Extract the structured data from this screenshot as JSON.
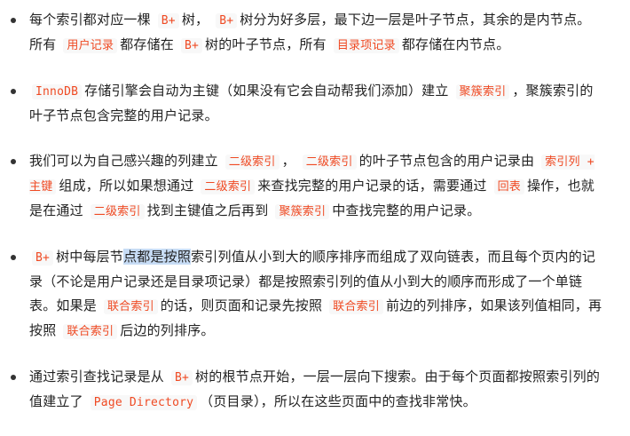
{
  "items": [
    [
      {
        "t": "每个索引都对应一棵 "
      },
      {
        "c": "B+"
      },
      {
        "t": "树， "
      },
      {
        "c": "B+"
      },
      {
        "t": "树分为好多层，最下边一层是叶子节点，其余的是内节点。所有 "
      },
      {
        "c": "用户记录"
      },
      {
        "t": "都存储在 "
      },
      {
        "c": "B+"
      },
      {
        "t": "树的叶子节点，所有 "
      },
      {
        "c": "目录项记录"
      },
      {
        "t": "都存储在内节点。"
      }
    ],
    [
      {
        "c": "InnoDB"
      },
      {
        "t": "存储引擎会自动为主键（如果没有它会自动帮我们添加）建立 "
      },
      {
        "c": "聚簇索引"
      },
      {
        "t": "，聚簇索引的叶子节点包含完整的用户记录。"
      }
    ],
    [
      {
        "t": "我们可以为自己感兴趣的列建立 "
      },
      {
        "c": "二级索引"
      },
      {
        "t": "， "
      },
      {
        "c": "二级索引"
      },
      {
        "t": "的叶子节点包含的用户记录由 "
      },
      {
        "c": "索引列 + 主键"
      },
      {
        "t": "组成，所以如果想通过 "
      },
      {
        "c": "二级索引"
      },
      {
        "t": "来查找完整的用户记录的话，需要通过 "
      },
      {
        "c": "回表"
      },
      {
        "t": "操作，也就是在通过 "
      },
      {
        "c": "二级索引"
      },
      {
        "t": "找到主键值之后再到 "
      },
      {
        "c": "聚簇索引"
      },
      {
        "t": "中查找完整的用户记录。"
      }
    ],
    [
      {
        "c": "B+"
      },
      {
        "t": "树中每层节"
      },
      {
        "s": "点都是按照"
      },
      {
        "t": "索引列值从小到大的顺序排序而组成了双向链表，而且每个页内的记录（不论是用户记录还是目录项记录）都是按照索引列的值从小到大的顺序而形成了一个单链表。如果是 "
      },
      {
        "c": "联合索引"
      },
      {
        "t": "的话，则页面和记录先按照 "
      },
      {
        "c": "联合索引"
      },
      {
        "t": "前边的列排序，如果该列值相同，再按照 "
      },
      {
        "c": "联合索引"
      },
      {
        "t": "后边的列排序。"
      }
    ],
    [
      {
        "t": "通过索引查找记录是从 "
      },
      {
        "c": "B+"
      },
      {
        "t": "树的根节点开始，一层一层向下搜索。由于每个页面都按照索引列的值建立了 "
      },
      {
        "c": "Page Directory"
      },
      {
        "t": "（页目录），所以在这些页面中的查找非常快。"
      }
    ]
  ]
}
